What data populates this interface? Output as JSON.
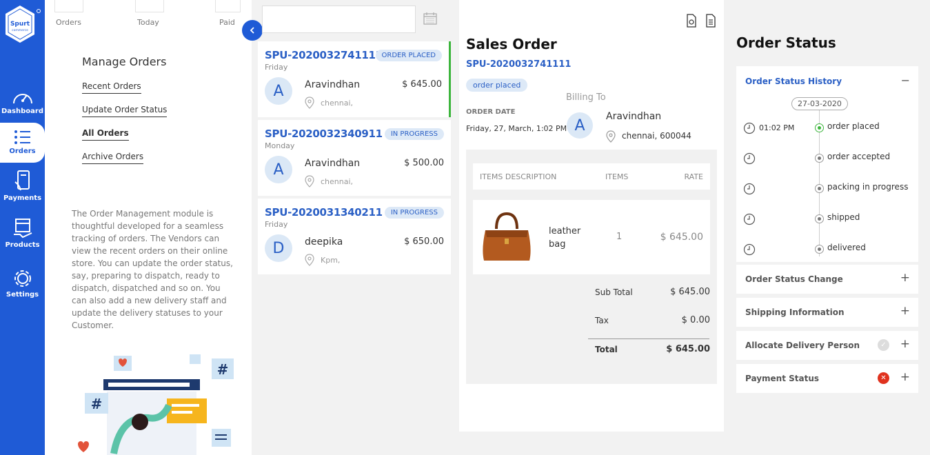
{
  "brand": {
    "logo_line1": "Spurt",
    "logo_line2": "commerce"
  },
  "nav": [
    {
      "label": "Dashboard",
      "icon": "gauge-icon",
      "active": false
    },
    {
      "label": "Orders",
      "icon": "list-icon",
      "active": true
    },
    {
      "label": "Payments",
      "icon": "card-icon",
      "active": false
    },
    {
      "label": "Products",
      "icon": "box-icon",
      "active": false
    },
    {
      "label": "Settings",
      "icon": "gear-icon",
      "active": false
    }
  ],
  "stats": {
    "labels": [
      "Orders",
      "Today",
      "Paid"
    ]
  },
  "manage": {
    "title": "Manage Orders",
    "links": [
      "Recent Orders",
      "Update Order Status",
      "All Orders",
      "Archive Orders"
    ],
    "active_link": "All Orders",
    "description": "The Order Management module is thoughtful developed for a seamless tracking of orders. The Vendors can view the recent orders on their online store. You can update the order status, say, preparing to dispatch, ready to dispatch, dispatched and so on. You can also add a new delivery staff and update the delivery statuses to your Customer."
  },
  "orders": [
    {
      "id": "SPU-2020032741111",
      "day": "Friday",
      "status": "ORDER PLACED",
      "initial": "A",
      "customer": "Aravindhan",
      "price": "$ 645.00",
      "city": "chennai,",
      "selected": true
    },
    {
      "id": "SPU-2020032340911",
      "day": "Monday",
      "status": "IN PROGRESS",
      "initial": "A",
      "customer": "Aravindhan",
      "price": "$ 500.00",
      "city": "chennai,",
      "selected": false
    },
    {
      "id": "SPU-2020031340211",
      "day": "Friday",
      "status": "IN PROGRESS",
      "initial": "D",
      "customer": "deepika",
      "price": "$ 650.00",
      "city": "Kpm,",
      "selected": false
    }
  ],
  "sales_order": {
    "title": "Sales Order",
    "id": "SPU-2020032741111",
    "badge": "order placed",
    "billing_label": "Billing To",
    "date_label": "ORDER DATE",
    "date": "Friday, 27, March, 1:02 PM",
    "initial": "A",
    "customer": "Aravindhan",
    "address": "chennai, 600044",
    "items_header": {
      "description": "ITEMS DESCRIPTION",
      "items": "ITEMS",
      "rate": "RATE"
    },
    "item": {
      "name_line1": "leather",
      "name_line2": "bag",
      "qty": "1",
      "rate": "$ 645.00"
    },
    "totals": {
      "subtotal_label": "Sub Total",
      "subtotal": "$ 645.00",
      "tax_label": "Tax",
      "tax": "$ 0.00",
      "total_label": "Total",
      "total": "$ 645.00"
    }
  },
  "order_status": {
    "title": "Order Status",
    "history_title": "Order Status History",
    "history_date": "27-03-2020",
    "history": [
      {
        "time": "01:02 PM",
        "label": "order placed",
        "done": true
      },
      {
        "time": "",
        "label": "order accepted",
        "done": false
      },
      {
        "time": "",
        "label": "packing in progress",
        "done": false
      },
      {
        "time": "",
        "label": "shipped",
        "done": false
      },
      {
        "time": "",
        "label": "delivered",
        "done": false
      }
    ],
    "sections": [
      "Order Status Change",
      "Shipping Information",
      "Allocate Delivery Person",
      "Payment Status"
    ]
  },
  "colors": {
    "primary": "#1f5bd6",
    "link": "#2a5fc5",
    "success": "#3cb53c",
    "danger": "#e0321e"
  }
}
